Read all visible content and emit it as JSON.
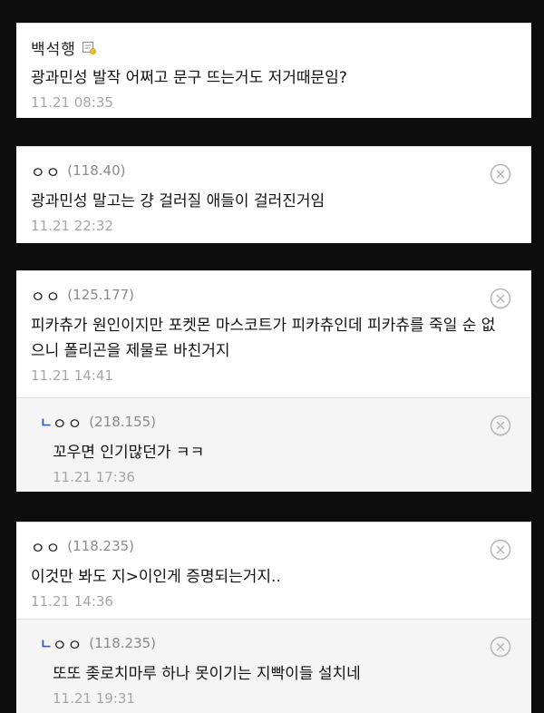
{
  "comments": [
    {
      "author": "백석행",
      "text": "광과민성 발작 어쩌고 문구 뜨는거도 저거때문임?",
      "date": "11.21 08:35",
      "icons": [
        "memo-icon"
      ]
    },
    {
      "author": "ㅇㅇ",
      "ip": "(118.40)",
      "text": "광과민성 말고는 걍 걸러질 애들이 걸러진거임",
      "date": "11.21 22:32",
      "icons": [
        "close-icon"
      ]
    },
    {
      "author": "ㅇㅇ",
      "ip": "(125.177)",
      "text": "피카츄가 원인이지만 포켓몬 마스코트가 피카츄인데 피카츄를 죽일 순 없으니 폴리곤을 제물로 바친거지",
      "date": "11.21 14:41",
      "icons": [
        "close-icon"
      ]
    },
    {
      "author": "ㅇㅇ",
      "ip": "(218.155)",
      "text": "꼬우면 인기많던가 ㅋㅋ",
      "date": "11.21 17:36",
      "reply_mark": "ㄴ",
      "icons": [
        "reply-mark",
        "close-icon"
      ]
    },
    {
      "author": "ㅇㅇ",
      "ip": "(118.235)",
      "text": "이것만 봐도 지>이인게 증명되는거지..",
      "date": "11.21 14:36",
      "icons": [
        "close-icon"
      ]
    },
    {
      "author": "ㅇㅇ",
      "ip": "(118.235)",
      "text": "또또 좆로치마루 하나 못이기는 지빡이들 설치네",
      "date": "11.21 19:31",
      "reply_mark": "ㄴ",
      "icons": [
        "reply-mark",
        "close-icon"
      ]
    }
  ]
}
